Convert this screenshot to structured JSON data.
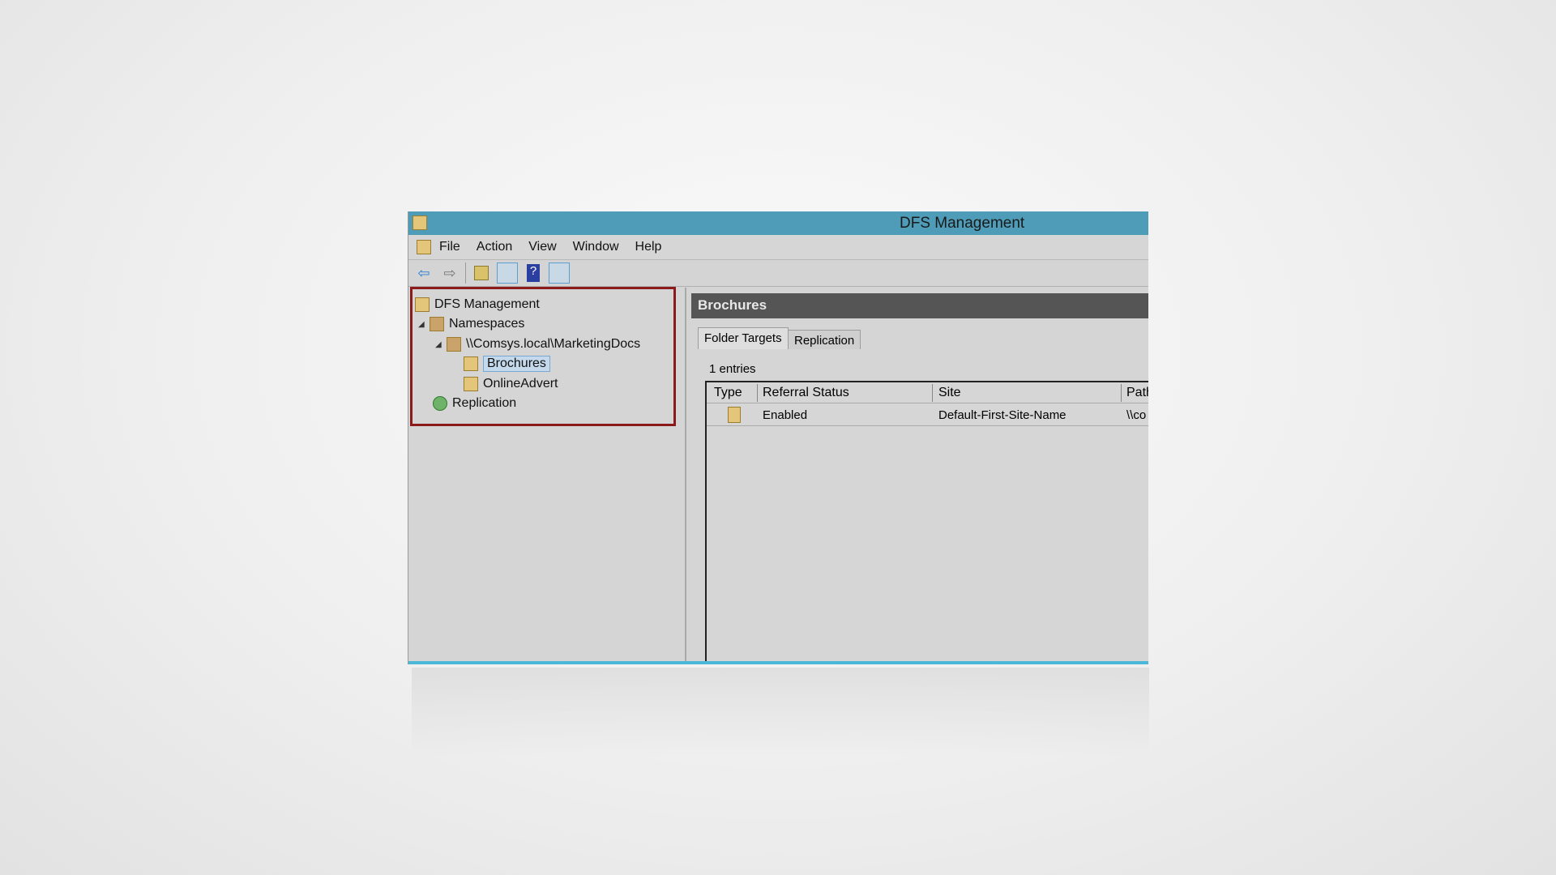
{
  "window": {
    "title": "DFS Management"
  },
  "menu": [
    "File",
    "Action",
    "View",
    "Window",
    "Help"
  ],
  "toolbar": {
    "icons": [
      "back-arrow-icon",
      "forward-arrow-icon",
      "up-folder-icon",
      "show-hide-tree-icon",
      "help-icon",
      "show-hide-action-pane-icon"
    ],
    "back": "⇦",
    "forward": "⇨",
    "help": "?"
  },
  "tree": [
    {
      "label": "DFS Management"
    },
    {
      "label": "Namespaces"
    },
    {
      "label": "\\\\Comsys.local\\MarketingDocs"
    },
    {
      "label": "Brochures",
      "selected": true
    },
    {
      "label": "OnlineAdvert"
    },
    {
      "label": "Replication"
    }
  ],
  "details": {
    "header": "Brochures",
    "tabs": [
      "Folder Targets",
      "Replication"
    ],
    "entries": "1 entries",
    "columns": [
      "Type",
      "Referral Status",
      "Site",
      "Path"
    ],
    "rows": [
      {
        "status": "Enabled",
        "site": "Default-First-Site-Name",
        "path": "\\\\co"
      }
    ]
  },
  "colors": {
    "title_bar": "#4e9cb8",
    "highlight_box": "#8b1a1a"
  }
}
